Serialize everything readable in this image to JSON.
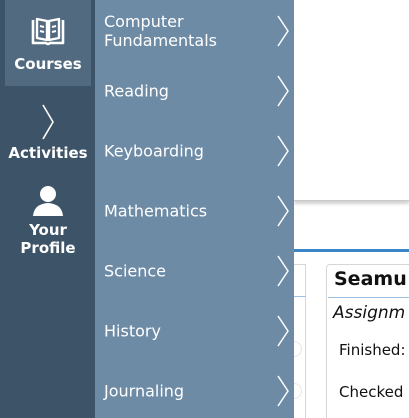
{
  "sidebar": {
    "items": [
      {
        "label": "Courses",
        "icon": "book-icon",
        "active": true
      },
      {
        "label": "Activities",
        "icon": "chevron-right-icon",
        "active": false
      },
      {
        "label": "Your Profile",
        "icon": "user-icon",
        "active": false
      }
    ]
  },
  "submenu": {
    "items": [
      {
        "label": "Computer Fundamentals"
      },
      {
        "label": "Reading"
      },
      {
        "label": "Keyboarding"
      },
      {
        "label": "Mathematics"
      },
      {
        "label": "Science"
      },
      {
        "label": "History"
      },
      {
        "label": "Journaling"
      }
    ]
  },
  "card": {
    "title": "Seamu",
    "subtitle": "Assignm",
    "line1": "Finished:",
    "line2": "Checked"
  },
  "colors": {
    "sidebar_bg": "#3d5367",
    "sidebar_active_bg": "#516a80",
    "submenu_bg": "#6e8ba6",
    "accent_blue": "#3a86c6"
  }
}
